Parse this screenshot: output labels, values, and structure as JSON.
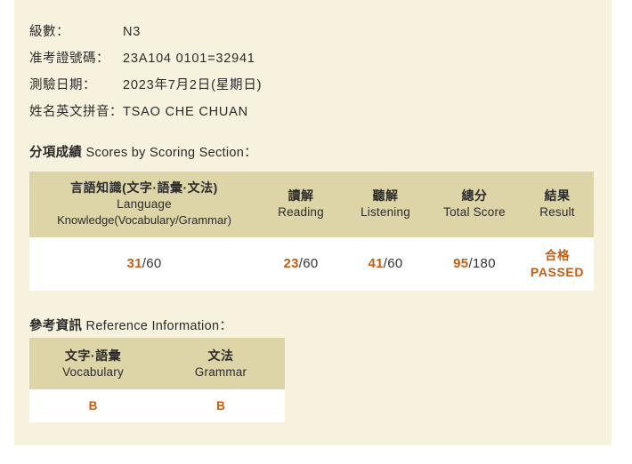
{
  "document": {
    "type": "jlpt-score-report",
    "colors": {
      "page_background": "#f6f2dd",
      "table_header": "#ddd4a8",
      "table_body": "#ffffff",
      "accent": "#c05f16",
      "text": "#2b2b2b"
    }
  },
  "info": {
    "rows": [
      {
        "label": "級數：",
        "value": "N3"
      },
      {
        "label": "准考證號碼：",
        "value": "23A104 0101=32941"
      },
      {
        "label": "測驗日期：",
        "value": "2023年7月2日(星期日)"
      },
      {
        "label": "姓名英文拼音：",
        "value": "TSAO CHE CHUAN"
      }
    ]
  },
  "scores_section": {
    "caption_cn": "分項成績",
    "caption_en": "Scores by Scoring Section",
    "caption_colon": "：",
    "columns": [
      {
        "cn": "言語知識(文字·語彙·文法)",
        "en_line1": "Language",
        "en_line2": "Knowledge(Vocabulary/Grammar)"
      },
      {
        "cn": "讀解",
        "en_line1": "Reading",
        "en_line2": ""
      },
      {
        "cn": "聽解",
        "en_line1": "Listening",
        "en_line2": ""
      },
      {
        "cn": "總分",
        "en_line1": "Total Score",
        "en_line2": ""
      },
      {
        "cn": "結果",
        "en_line1": "Result",
        "en_line2": ""
      }
    ],
    "values": {
      "language_knowledge_score": "31",
      "language_knowledge_max": "/60",
      "reading_score": "23",
      "reading_max": "/60",
      "listening_score": "41",
      "listening_max": "/60",
      "total_score": "95",
      "total_max": "/180",
      "result_cn": "合格",
      "result_en": "PASSED"
    }
  },
  "reference_section": {
    "caption_cn": "參考資訊",
    "caption_en": "Reference Information",
    "caption_colon": "：",
    "columns": [
      {
        "cn": "文字·語彙",
        "en": "Vocabulary"
      },
      {
        "cn": "文法",
        "en": "Grammar"
      }
    ],
    "values": {
      "vocabulary_grade": "B",
      "grammar_grade": "B"
    }
  }
}
